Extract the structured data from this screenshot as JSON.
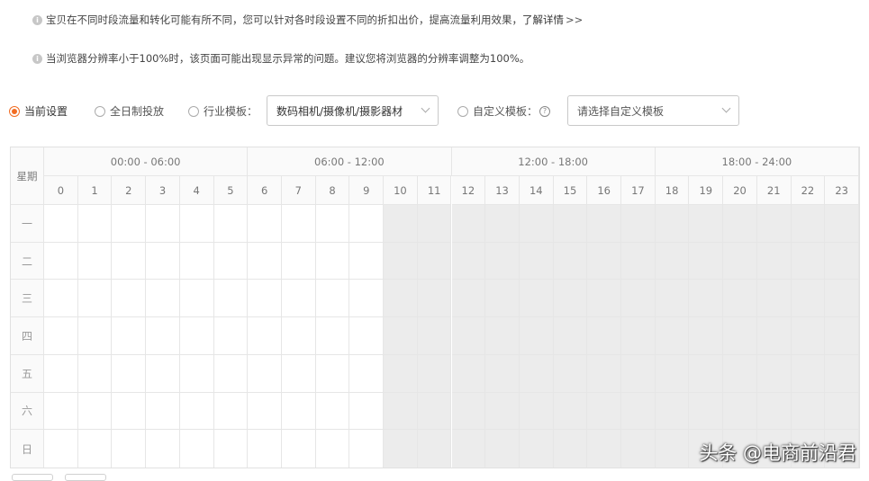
{
  "notices": [
    {
      "text": "宝贝在不同时段流量和转化可能有所不同，您可以针对各时段设置不同的折扣出价，提高流量利用效果，",
      "link": "了解详情",
      "arrows": ">>"
    },
    {
      "text": "当浏览器分辨率小于100%时，该页面可能出现显示异常的问题。建议您将浏览器的分辨率调整为100%。"
    }
  ],
  "info_icon_glyph": "i",
  "options": {
    "current": "当前设置",
    "allday": "全日制投放",
    "industry": "行业模板：",
    "industry_select": "数码相机/摄像机/摄影器材",
    "custom": "自定义模板：",
    "help_glyph": "?",
    "custom_placeholder": "请选择自定义模板",
    "selected": "current"
  },
  "grid": {
    "corner": "星期",
    "periods": [
      "00:00 - 06:00",
      "06:00 - 12:00",
      "12:00 - 18:00",
      "18:00 - 24:00"
    ],
    "hours": [
      "0",
      "1",
      "2",
      "3",
      "4",
      "5",
      "6",
      "7",
      "8",
      "9",
      "10",
      "11",
      "12",
      "13",
      "14",
      "15",
      "16",
      "17",
      "18",
      "19",
      "20",
      "21",
      "22",
      "23"
    ],
    "days": [
      "一",
      "二",
      "三",
      "四",
      "五",
      "六",
      "日"
    ],
    "shaded_from_hour": 10,
    "colors": {
      "border": "#e6e6e6",
      "shaded": "#ececec",
      "accent": "#f26c22"
    }
  },
  "watermark": "头条 @电商前沿君"
}
